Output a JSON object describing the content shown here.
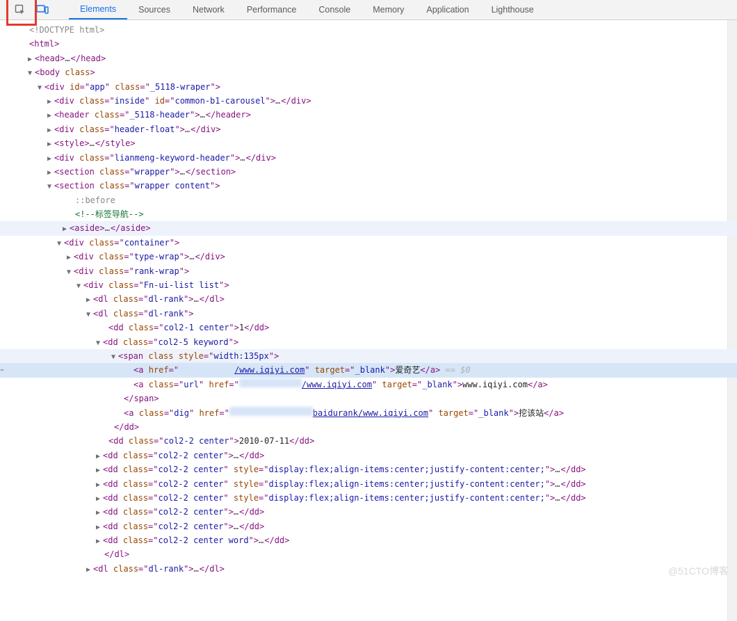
{
  "toolbar": {
    "tabs": [
      "Elements",
      "Sources",
      "Network",
      "Performance",
      "Console",
      "Memory",
      "Application",
      "Lighthouse"
    ],
    "active_tab": 0
  },
  "dom": {
    "doctype": "<!DOCTYPE html>",
    "html_open": "html",
    "head": {
      "tag": "head",
      "ellipsis": "…"
    },
    "body": {
      "tag": "body",
      "attr": "class"
    },
    "app": {
      "tag": "div",
      "id": "app",
      "class": "_5118-wraper"
    },
    "children": [
      {
        "tag": "div",
        "class": "inside",
        "id": "common-b1-carousel",
        "ell": "…",
        "close": "div"
      },
      {
        "tag": "header",
        "class": "_5118-header",
        "ell": "…",
        "close": "header"
      },
      {
        "tag": "div",
        "class": "header-float",
        "ell": "…",
        "close": "div"
      },
      {
        "tag": "style",
        "ell": "…",
        "close": "style"
      },
      {
        "tag": "div",
        "class": "lianmeng-keyword-header",
        "ell": "…",
        "close": "div"
      },
      {
        "tag": "section",
        "class": "wrapper",
        "ell": "…",
        "close": "section"
      }
    ],
    "section_content": {
      "tag": "section",
      "class": "wrapper content"
    },
    "pseudo_before": "::before",
    "comment_nav": "<!--标签导航-->",
    "aside": {
      "tag": "aside",
      "ell": "…",
      "close": "aside"
    },
    "container": {
      "tag": "div",
      "class": "container"
    },
    "type_wrap": {
      "tag": "div",
      "class": "type-wrap",
      "ell": "…",
      "close": "div"
    },
    "rank_wrap": {
      "tag": "div",
      "class": "rank-wrap"
    },
    "fn_ui_list": {
      "tag": "div",
      "class": "Fn-ui-list list"
    },
    "dl_rank_1": {
      "tag": "dl",
      "class": "dl-rank",
      "ell": "…",
      "close": "dl"
    },
    "dl_rank_2": {
      "tag": "dl",
      "class": "dl-rank"
    },
    "dd_col21": {
      "tag": "dd",
      "class": "col2-1 center",
      "text": "1",
      "close": "dd"
    },
    "dd_keyword": {
      "tag": "dd",
      "class": "col2-5 keyword"
    },
    "span_style": {
      "tag": "span",
      "attr1": "class",
      "style": "width:135px"
    },
    "a1": {
      "href_vis": "/www.iqiyi.com",
      "target": "_blank",
      "text": "爱奇艺",
      "eq": " == $0"
    },
    "a2": {
      "class": "url",
      "href_vis": "/www.iqiyi.com",
      "target": "_blank",
      "text": "www.iqiyi.com"
    },
    "span_close": "span",
    "a3": {
      "class": "dig",
      "href_vis": "baidurank/www.iqiyi.com",
      "target": "_blank",
      "text": "挖该站"
    },
    "dd_close": "dd",
    "dd_date": {
      "tag": "dd",
      "class": "col2-2 center",
      "text": "2010-07-11",
      "close": "dd"
    },
    "dd_plain": [
      {
        "tag": "dd",
        "class": "col2-2 center",
        "ell": "…",
        "close": "dd"
      },
      {
        "tag": "dd",
        "class": "col2-2 center",
        "style": "display:flex;align-items:center;justify-content:center;",
        "ell": "…",
        "close": "dd"
      },
      {
        "tag": "dd",
        "class": "col2-2 center",
        "style": "display:flex;align-items:center;justify-content:center;",
        "ell": "…",
        "close": "dd"
      },
      {
        "tag": "dd",
        "class": "col2-2 center",
        "style": "display:flex;align-items:center;justify-content:center;",
        "ell": "…",
        "close": "dd"
      },
      {
        "tag": "dd",
        "class": "col2-2 center",
        "ell": "…",
        "close": "dd"
      },
      {
        "tag": "dd",
        "class": "col2-2 center",
        "ell": "…",
        "close": "dd"
      },
      {
        "tag": "dd",
        "class": "col2-2 center word",
        "ell": "…",
        "close": "dd"
      }
    ],
    "dl_close": "dl",
    "dl_rank_3": {
      "tag": "dl",
      "class": "dl-rank",
      "ell": "…",
      "close": "dl"
    }
  },
  "watermark": "@51CTO博客"
}
